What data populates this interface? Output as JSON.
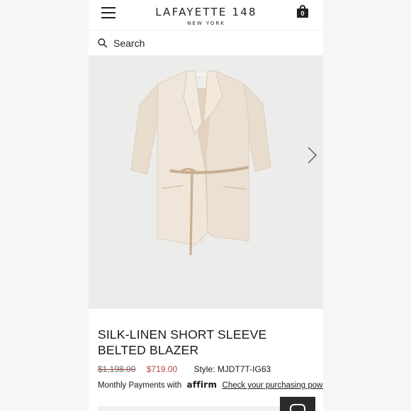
{
  "header": {
    "brand_name": "LAFAYETTE 148",
    "brand_location": "NEW YORK",
    "bag_count": "0"
  },
  "search": {
    "label": "Search"
  },
  "product": {
    "title": "SILK-LINEN SHORT SLEEVE BELTED BLAZER",
    "original_price": "$1,198.00",
    "sale_price": "$719.00",
    "style": "Style: MJDT7T-IG63",
    "financing_label": "Monthly Payments with",
    "financing_brand": "affirm",
    "financing_link": "Check your purchasing power"
  },
  "colors": {
    "sale_price": "#b4453c",
    "blazer": "#eee3d6",
    "belt": "#c7ae8f",
    "gallery_bg": "#ececeb"
  },
  "icons": {
    "menu": "hamburger-icon",
    "bag": "shopping-bag-icon",
    "search": "search-icon",
    "next": "chevron-right-icon",
    "chat": "chat-icon"
  }
}
